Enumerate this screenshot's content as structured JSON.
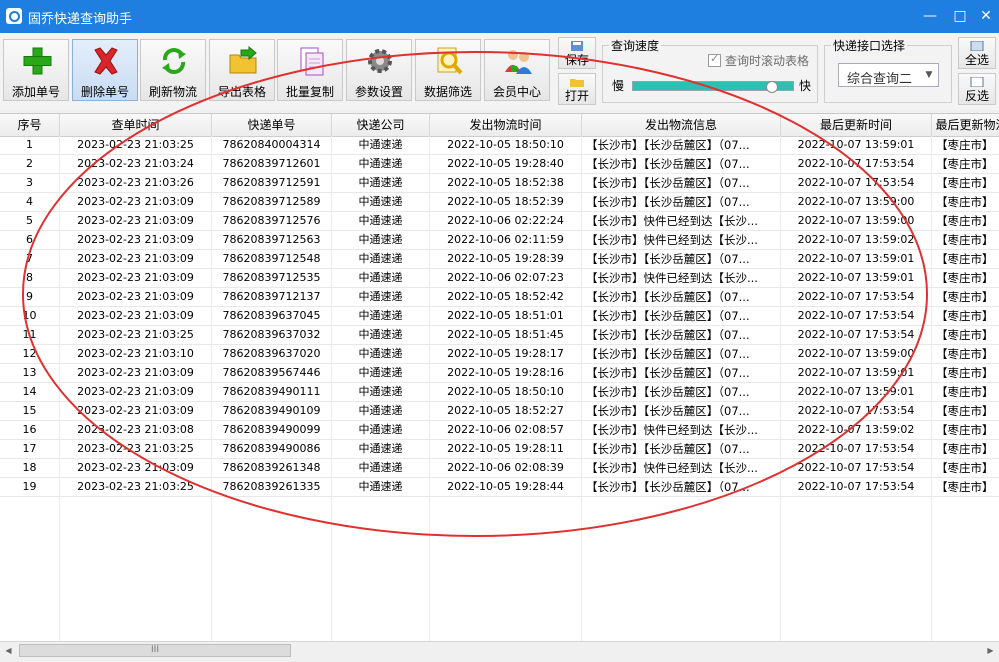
{
  "window": {
    "title": "固乔快递查询助手",
    "minimize": "—",
    "maximize": "□",
    "close": "✕"
  },
  "toolbar": {
    "buttons": [
      {
        "label": "添加单号",
        "icon": "add-plus-icon"
      },
      {
        "label": "删除单号",
        "icon": "delete-x-icon"
      },
      {
        "label": "刷新物流",
        "icon": "refresh-icon"
      },
      {
        "label": "导出表格",
        "icon": "export-folder-icon"
      },
      {
        "label": "批量复制",
        "icon": "copy-documents-icon"
      },
      {
        "label": "参数设置",
        "icon": "settings-gear-icon"
      },
      {
        "label": "数据筛选",
        "icon": "filter-search-icon"
      },
      {
        "label": "会员中心",
        "icon": "members-icon"
      }
    ],
    "save_label": "保存",
    "open_label": "打开",
    "select_all_label": "全选",
    "invert_label": "反选"
  },
  "speed": {
    "legend": "查询速度",
    "scroll_label": "查询时滚动表格",
    "scroll_checked": true,
    "slow_label": "慢",
    "fast_label": "快",
    "level": 0.86
  },
  "api": {
    "legend": "快递接口选择",
    "selected": "综合查询二"
  },
  "colors": {
    "titlebar": "#1e7fe0",
    "slider": "#2bc0b3",
    "annotation": "#e03030"
  },
  "table": {
    "columns": [
      "序号",
      "查单时间",
      "快递单号",
      "快递公司",
      "发出物流时间",
      "发出物流信息",
      "最后更新时间",
      "最后更新物流"
    ],
    "rows": [
      [
        "1",
        "2023-02-23 21:03:25",
        "78620840004314",
        "中通速递",
        "2022-10-05 18:50:10",
        "【长沙市】【长沙岳麓区】（07...",
        "2022-10-07 13:59:01",
        "【枣庄市】"
      ],
      [
        "2",
        "2023-02-23 21:03:24",
        "78620839712601",
        "中通速递",
        "2022-10-05 19:28:40",
        "【长沙市】【长沙岳麓区】（07...",
        "2022-10-07 17:53:54",
        "【枣庄市】"
      ],
      [
        "3",
        "2023-02-23 21:03:26",
        "78620839712591",
        "中通速递",
        "2022-10-05 18:52:38",
        "【长沙市】【长沙岳麓区】（07...",
        "2022-10-07 17:53:54",
        "【枣庄市】"
      ],
      [
        "4",
        "2023-02-23 21:03:09",
        "78620839712589",
        "中通速递",
        "2022-10-05 18:52:39",
        "【长沙市】【长沙岳麓区】（07...",
        "2022-10-07 13:59:00",
        "【枣庄市】"
      ],
      [
        "5",
        "2023-02-23 21:03:09",
        "78620839712576",
        "中通速递",
        "2022-10-06 02:22:24",
        "【长沙市】快件已经到达【长沙...",
        "2022-10-07 13:59:00",
        "【枣庄市】"
      ],
      [
        "6",
        "2023-02-23 21:03:09",
        "78620839712563",
        "中通速递",
        "2022-10-06 02:11:59",
        "【长沙市】快件已经到达【长沙...",
        "2022-10-07 13:59:02",
        "【枣庄市】"
      ],
      [
        "7",
        "2023-02-23 21:03:09",
        "78620839712548",
        "中通速递",
        "2022-10-05 19:28:39",
        "【长沙市】【长沙岳麓区】（07...",
        "2022-10-07 13:59:01",
        "【枣庄市】"
      ],
      [
        "8",
        "2023-02-23 21:03:09",
        "78620839712535",
        "中通速递",
        "2022-10-06 02:07:23",
        "【长沙市】快件已经到达【长沙...",
        "2022-10-07 13:59:01",
        "【枣庄市】"
      ],
      [
        "9",
        "2023-02-23 21:03:09",
        "78620839712137",
        "中通速递",
        "2022-10-05 18:52:42",
        "【长沙市】【长沙岳麓区】（07...",
        "2022-10-07 17:53:54",
        "【枣庄市】"
      ],
      [
        "10",
        "2023-02-23 21:03:09",
        "78620839637045",
        "中通速递",
        "2022-10-05 18:51:01",
        "【长沙市】【长沙岳麓区】（07...",
        "2022-10-07 17:53:54",
        "【枣庄市】"
      ],
      [
        "11",
        "2023-02-23 21:03:25",
        "78620839637032",
        "中通速递",
        "2022-10-05 18:51:45",
        "【长沙市】【长沙岳麓区】（07...",
        "2022-10-07 17:53:54",
        "【枣庄市】"
      ],
      [
        "12",
        "2023-02-23 21:03:10",
        "78620839637020",
        "中通速递",
        "2022-10-05 19:28:17",
        "【长沙市】【长沙岳麓区】（07...",
        "2022-10-07 13:59:00",
        "【枣庄市】"
      ],
      [
        "13",
        "2023-02-23 21:03:09",
        "78620839567446",
        "中通速递",
        "2022-10-05 19:28:16",
        "【长沙市】【长沙岳麓区】（07...",
        "2022-10-07 13:59:01",
        "【枣庄市】"
      ],
      [
        "14",
        "2023-02-23 21:03:09",
        "78620839490111",
        "中通速递",
        "2022-10-05 18:50:10",
        "【长沙市】【长沙岳麓区】（07...",
        "2022-10-07 13:59:01",
        "【枣庄市】"
      ],
      [
        "15",
        "2023-02-23 21:03:09",
        "78620839490109",
        "中通速递",
        "2022-10-05 18:52:27",
        "【长沙市】【长沙岳麓区】（07...",
        "2022-10-07 17:53:54",
        "【枣庄市】"
      ],
      [
        "16",
        "2023-02-23 21:03:08",
        "78620839490099",
        "中通速递",
        "2022-10-06 02:08:57",
        "【长沙市】快件已经到达【长沙...",
        "2022-10-07 13:59:02",
        "【枣庄市】"
      ],
      [
        "17",
        "2023-02-23 21:03:25",
        "78620839490086",
        "中通速递",
        "2022-10-05 19:28:11",
        "【长沙市】【长沙岳麓区】（07...",
        "2022-10-07 17:53:54",
        "【枣庄市】"
      ],
      [
        "18",
        "2023-02-23 21:03:09",
        "78620839261348",
        "中通速递",
        "2022-10-06 02:08:39",
        "【长沙市】快件已经到达【长沙...",
        "2022-10-07 17:53:54",
        "【枣庄市】"
      ],
      [
        "19",
        "2023-02-23 21:03:25",
        "78620839261335",
        "中通速递",
        "2022-10-05 19:28:44",
        "【长沙市】【长沙岳麓区】（07...",
        "2022-10-07 17:53:54",
        "【枣庄市】"
      ]
    ]
  },
  "scrollbar": {
    "thumb_grip": "III",
    "left_arrow": "◀",
    "right_arrow": "▶"
  }
}
